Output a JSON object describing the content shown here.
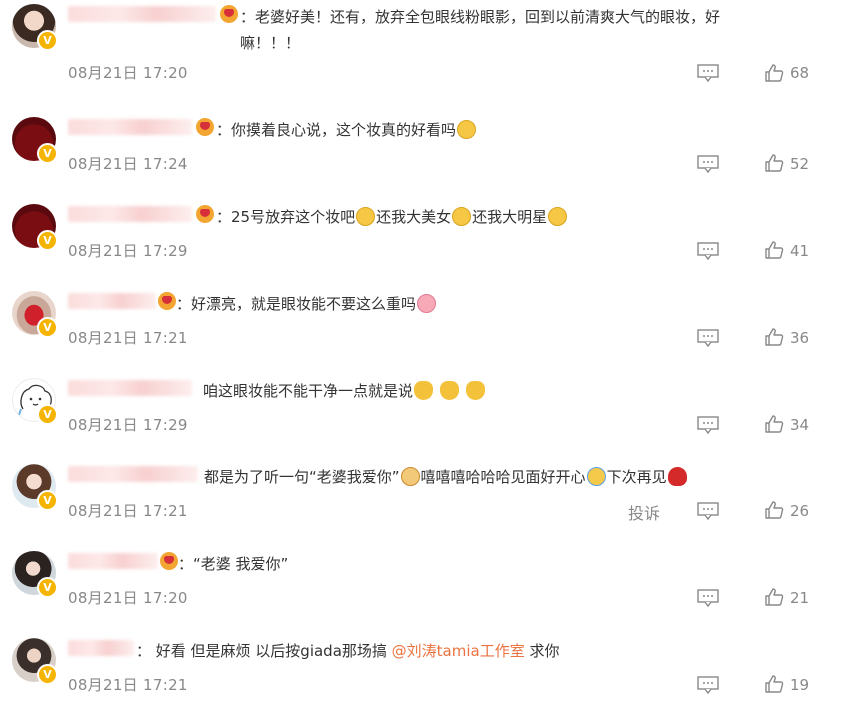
{
  "comments": [
    {
      "text": "：老婆好美！还有，放弃全包眼线粉眼影，回到以前清爽大气的眼妆，好嘛！！！",
      "time": "08月21日 17:20",
      "likes": "68",
      "verified": "V"
    },
    {
      "text": "：你摸着良心说，这个妆真的好看吗",
      "time": "08月21日 17:24",
      "likes": "52",
      "verified": "V"
    },
    {
      "text_a": "：25号放弃这个妆吧",
      "text_b": "还我大美女",
      "text_c": "还我大明星",
      "time": "08月21日 17:29",
      "likes": "41",
      "verified": "V"
    },
    {
      "text": "：好漂亮，就是眼妆能不要这么重吗",
      "time": "08月21日 17:21",
      "likes": "36",
      "verified": "V"
    },
    {
      "text": "咱这眼妆能不能干净一点就是说",
      "time": "08月21日 17:29",
      "likes": "34",
      "verified": "V"
    },
    {
      "text_a": "都是为了听一句“老婆我爱你”",
      "text_b": "嘻嘻嘻哈哈哈见面好开心",
      "text_c": "下次再见",
      "time": "08月21日 17:21",
      "likes": "26",
      "report": "投诉",
      "verified": "V"
    },
    {
      "text": "：“老婆 我爱你”",
      "time": "08月21日 17:20",
      "likes": "21",
      "verified": "V"
    },
    {
      "text_a": "： 好看 但是麻烦 以后按giada那场搞 ",
      "mention": "@刘涛tamia工作室",
      "text_b": " 求你",
      "time": "08月21日 17:21",
      "likes": "19",
      "verified": "V"
    }
  ],
  "icons": {
    "reply": "comment-icon",
    "like": "thumb-up-icon",
    "verified": "verified-badge-icon"
  },
  "colors": {
    "mention": "#eb7340",
    "meta": "#888888",
    "verified": "#f5b400"
  }
}
